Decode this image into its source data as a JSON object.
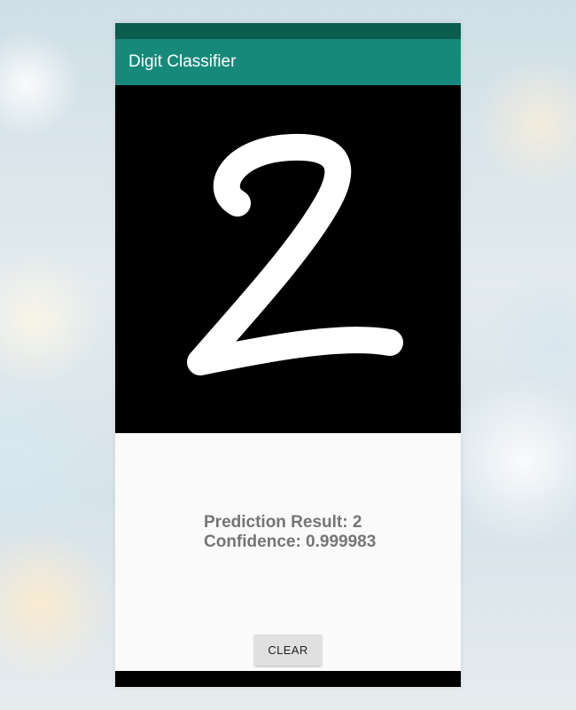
{
  "app_bar": {
    "title": "Digit Classifier"
  },
  "canvas": {
    "drawn_digit_icon": "handwritten-digit-2"
  },
  "result": {
    "prediction": "Prediction Result: 2",
    "confidence": "Confidence: 0.999983"
  },
  "clear_button": {
    "label": "CLEAR"
  },
  "colors": {
    "status_bar": "#0b5d50",
    "app_bar": "#17897a",
    "canvas_bg": "#000000",
    "stroke": "#ffffff",
    "result_text": "#757575",
    "button_bg": "#e0e0e0"
  }
}
